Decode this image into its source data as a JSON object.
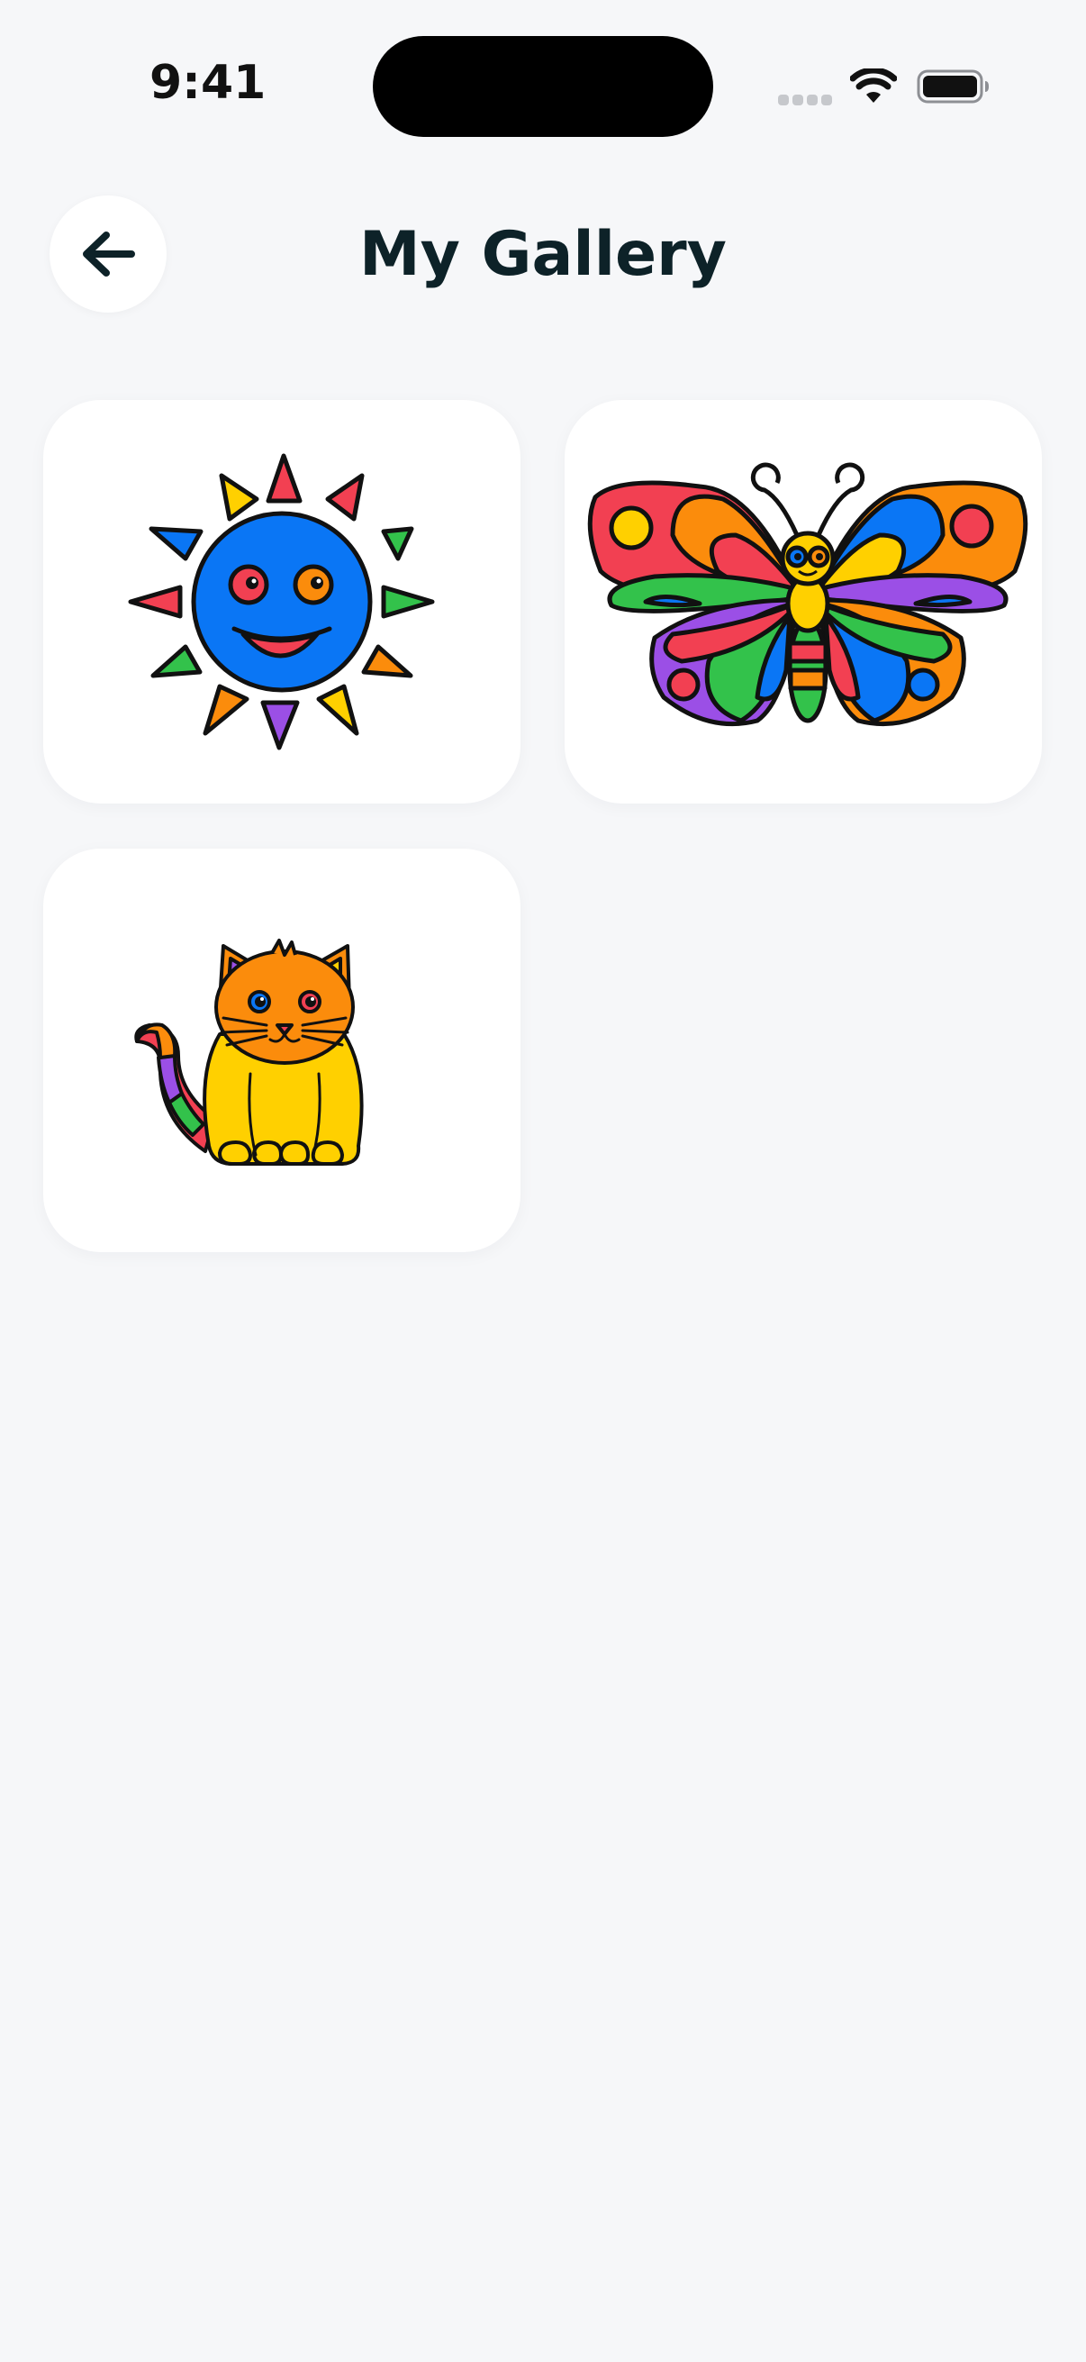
{
  "status_bar": {
    "time": "9:41",
    "icons": [
      "cellular-signal-icon",
      "wifi-icon",
      "battery-icon"
    ]
  },
  "header": {
    "back_icon": "arrow-left-icon",
    "title": "My Gallery"
  },
  "gallery": {
    "items": [
      {
        "subject": "sun"
      },
      {
        "subject": "butterfly"
      },
      {
        "subject": "cat"
      }
    ]
  },
  "colors": {
    "background": "#f6f7f9",
    "card": "#ffffff",
    "title": "#0d2228",
    "blue": "#0a76f5",
    "red": "#f24052",
    "orange": "#fb8c0c",
    "yellow": "#ffd000",
    "green": "#33c24b",
    "purple": "#9b4fe6"
  }
}
